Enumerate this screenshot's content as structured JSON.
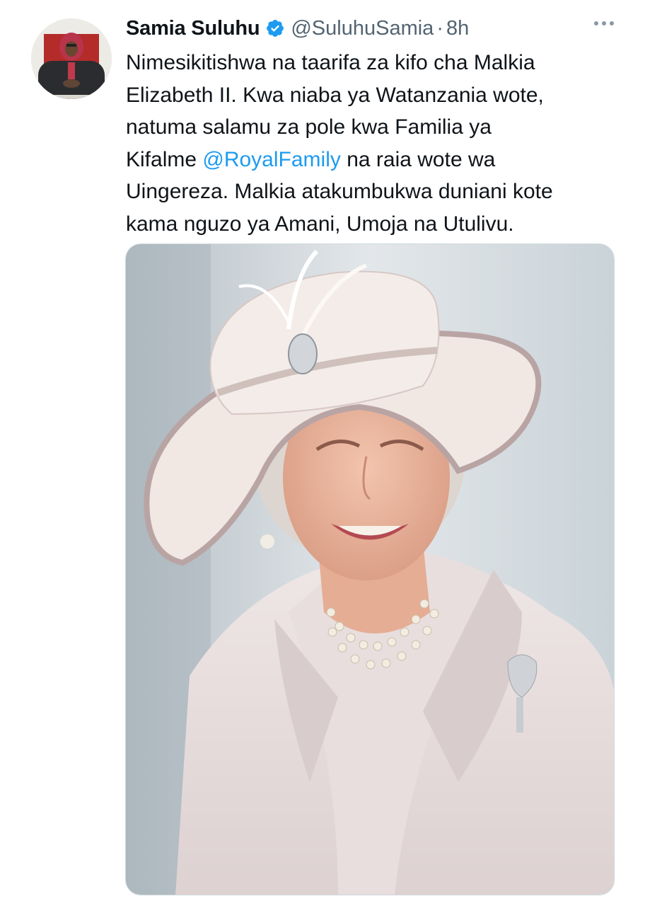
{
  "tweet": {
    "author": {
      "display_name": "Samia Suluhu",
      "handle": "@SuluhuSamia",
      "verified": true
    },
    "separator": "·",
    "time": "8h",
    "text_lines": [
      {
        "before": "Nimesikitishwa na taarifa za kifo cha Malkia",
        "mention": "",
        "after": ""
      },
      {
        "before": "Elizabeth II. Kwa niaba ya Watanzania wote,",
        "mention": "",
        "after": ""
      },
      {
        "before": "natuma salamu za pole kwa Familia ya",
        "mention": "",
        "after": ""
      },
      {
        "before": "Kifalme ",
        "mention": "@RoyalFamily",
        "after": " na raia wote wa"
      },
      {
        "before": "Uingereza. Malkia atakumbukwa duniani kote",
        "mention": "",
        "after": ""
      },
      {
        "before": "kama nguzo ya Amani, Umoja na Utulivu.",
        "mention": "",
        "after": ""
      }
    ],
    "colors": {
      "text": "#0f1419",
      "secondary": "#536471",
      "link": "#1d9bf0",
      "verified": "#1d9bf0"
    },
    "icons": {
      "verified": "verified-badge-icon",
      "more": "more-options-icon"
    }
  }
}
